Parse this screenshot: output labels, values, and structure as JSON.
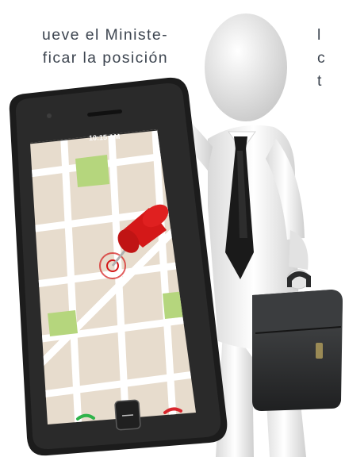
{
  "text_left": {
    "line1": "ueve el Ministe-",
    "line2": "ficar la posición"
  },
  "text_right": {
    "line1": "l",
    "line2": "c",
    "line3": "t"
  },
  "phone": {
    "status_time": "10:15 AM"
  },
  "colors": {
    "text": "#3d4550",
    "phone_body": "#1c1c1c",
    "map_street": "#ffffff",
    "map_block": "#e7dccd",
    "map_park": "#b5d67d",
    "pin": "#d41818",
    "call_button": "#2fb34a",
    "end_button": "#d8262d",
    "suit": "#f2f2f2",
    "tie": "#1a1a1a",
    "briefcase": "#2f3133"
  },
  "icons": [
    "map-pin-icon",
    "call-icon",
    "end-call-icon",
    "signal-icon",
    "battery-icon",
    "home-button-icon"
  ]
}
